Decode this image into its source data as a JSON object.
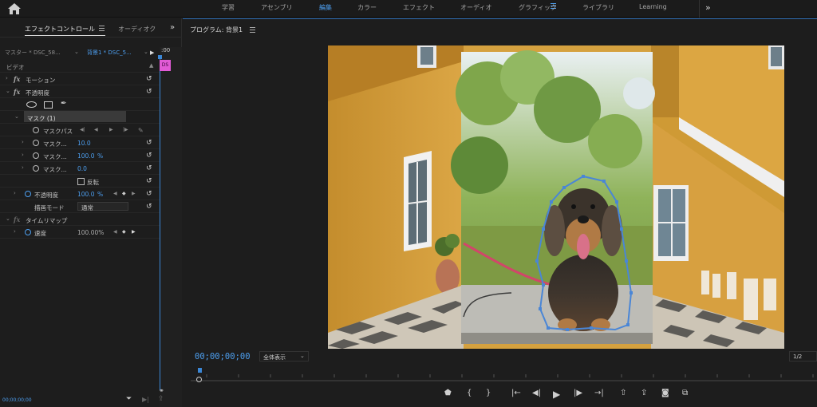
{
  "topbar": {
    "workspaces": [
      {
        "label": "学習",
        "active": false
      },
      {
        "label": "アセンブリ",
        "active": false
      },
      {
        "label": "編集",
        "active": true
      },
      {
        "label": "カラー",
        "active": false
      },
      {
        "label": "エフェクト",
        "active": false
      },
      {
        "label": "オーディオ",
        "active": false
      },
      {
        "label": "グラフィック",
        "active": false
      },
      {
        "label": "ライブラリ",
        "active": false
      },
      {
        "label": "Learning",
        "active": false
      }
    ],
    "more_icon": "»"
  },
  "effect_controls": {
    "tab_active": "エフェクトコントロール",
    "tab_other": "オーディオク",
    "clip_master": "マスター * DSC_58...",
    "clip_sequence": "背景1 * DSC_5...",
    "timeline_time": ":00",
    "clip_badge": "DS",
    "section_video": "ビデオ",
    "motion": "モーション",
    "opacity_fx": "不透明度",
    "mask_name": "マスク (1)",
    "mask_path": "マスクパス",
    "mask_feather_label": "マスク...",
    "mask_feather_val": "10.0",
    "mask_opacity_label": "マスク...",
    "mask_opacity_val": "100.0",
    "mask_opacity_unit": "%",
    "mask_expand_label": "マスク...",
    "mask_expand_val": "0.0",
    "invert_label": "反転",
    "opacity_label": "不透明度",
    "opacity_val": "100.0",
    "opacity_unit": "%",
    "blend_label": "描画モード",
    "blend_val": "通常",
    "time_remap": "タイムリマップ",
    "speed_label": "速度",
    "speed_val": "100.00%",
    "footer_timecode": "00;00;00;00"
  },
  "program": {
    "title": "プログラム: 背景1",
    "timecode": "00;00;00;00",
    "fit": "全体表示",
    "resolution": "1/2"
  },
  "colors": {
    "accent": "#4d9ff0",
    "wall": "#d5a13f",
    "mask_path": "#4a86d6"
  }
}
